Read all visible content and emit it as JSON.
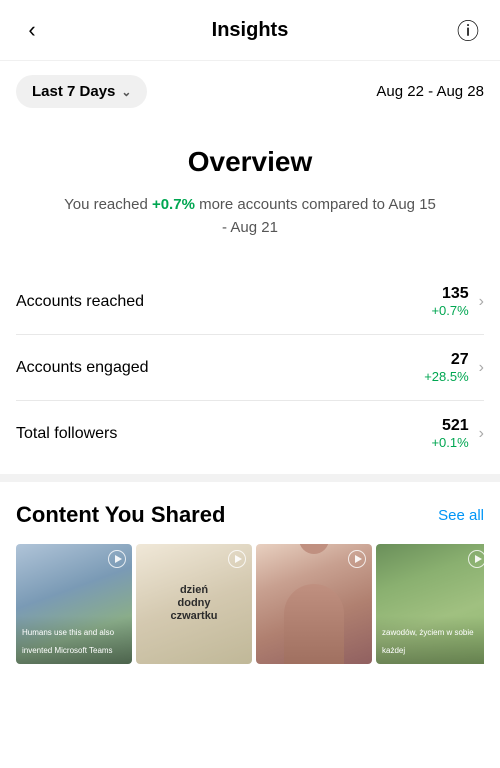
{
  "header": {
    "title": "Insights",
    "back_label": "‹",
    "info_label": "ⓘ"
  },
  "date_filter": {
    "label": "Last 7 Days",
    "chevron": "∨",
    "range": "Aug 22 - Aug 28"
  },
  "overview": {
    "title": "Overview",
    "subtitle_pre": "You reached ",
    "subtitle_highlight": "+0.7%",
    "subtitle_post": " more accounts compared to Aug 15 - Aug 21"
  },
  "stats": [
    {
      "label": "Accounts reached",
      "number": "135",
      "change": "+0.7%"
    },
    {
      "label": "Accounts engaged",
      "number": "27",
      "change": "+28.5%"
    },
    {
      "label": "Total followers",
      "number": "521",
      "change": "+0.1%"
    }
  ],
  "content_section": {
    "title": "Content You Shared",
    "see_all": "See all"
  },
  "thumbnails": [
    {
      "id": 1,
      "caption": "Humans use this and also invented Microsoft Teams"
    },
    {
      "id": 2,
      "big_text": "dzień\ndodny\nczwartku",
      "sub_text": ""
    },
    {
      "id": 3,
      "caption": ""
    },
    {
      "id": 4,
      "caption": "zawodów, życiem\nw sobie każdej"
    }
  ]
}
